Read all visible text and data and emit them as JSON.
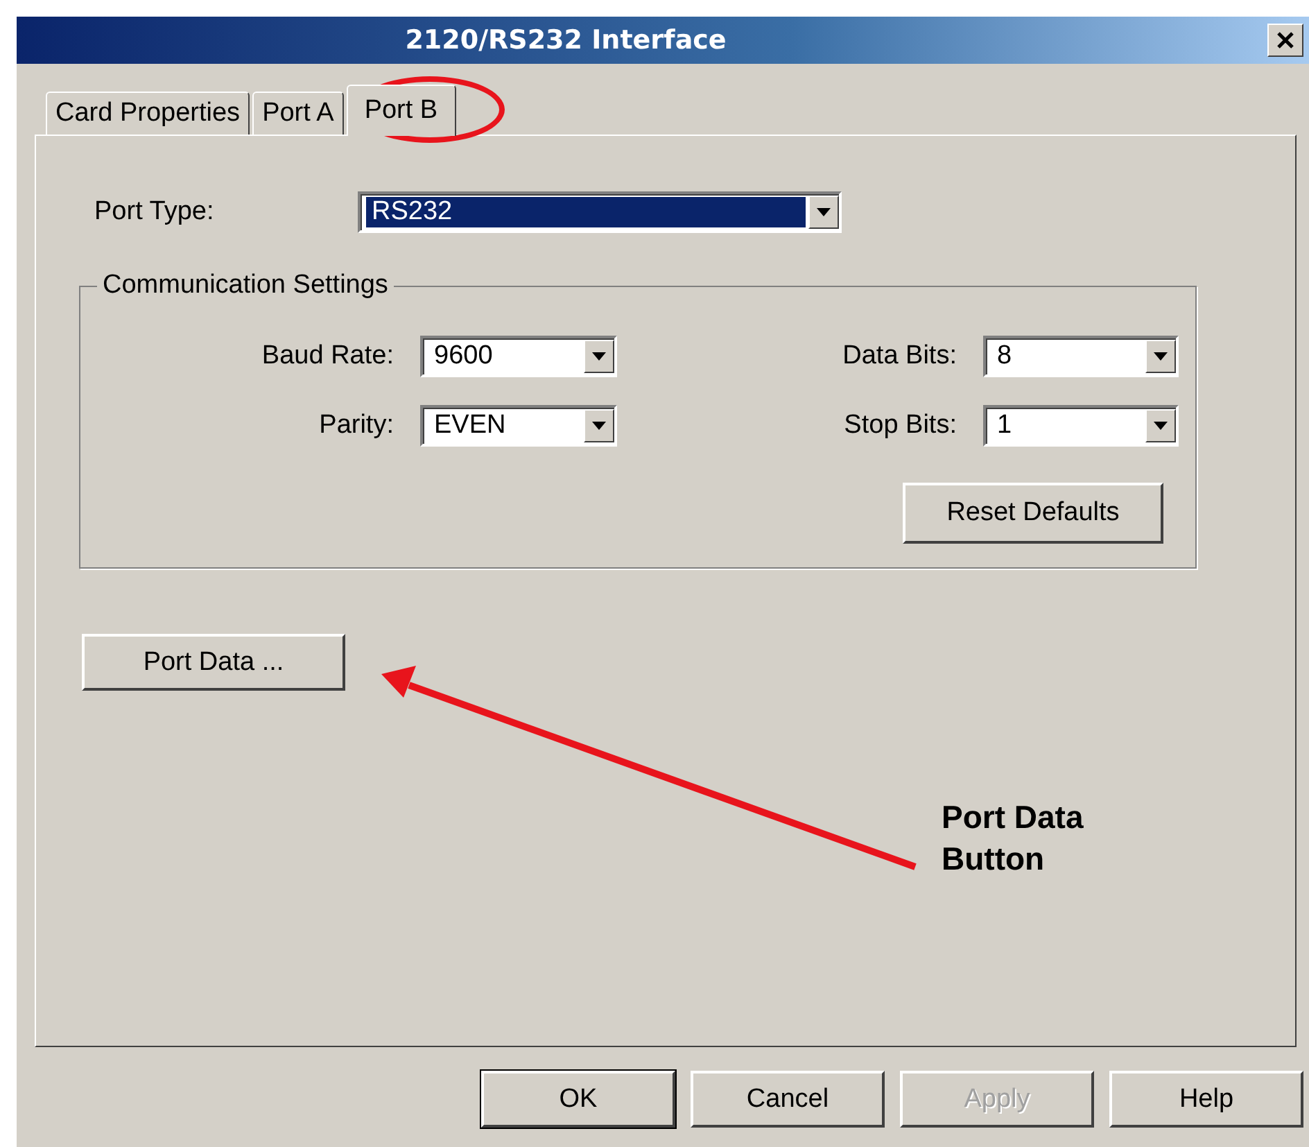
{
  "window": {
    "title": "2120/RS232 Interface"
  },
  "tabs": [
    {
      "label": "Card Properties",
      "selected": false
    },
    {
      "label": "Port A",
      "selected": false
    },
    {
      "label": "Port B",
      "selected": true
    }
  ],
  "port_type": {
    "label": "Port Type:",
    "value": "RS232",
    "focused": true
  },
  "communication_settings": {
    "title": "Communication Settings",
    "fields": [
      {
        "label": "Baud Rate:",
        "value": "9600"
      },
      {
        "label": "Data Bits:",
        "value": "8"
      },
      {
        "label": "Parity:",
        "value": "EVEN"
      },
      {
        "label": "Stop Bits:",
        "value": "1"
      }
    ],
    "reset_button": "Reset Defaults"
  },
  "port_data_button": "Port Data ...",
  "annotation": {
    "text": "Port Data Button"
  },
  "buttons": [
    {
      "label": "OK",
      "default": true,
      "disabled": false
    },
    {
      "label": "Cancel",
      "default": false,
      "disabled": false
    },
    {
      "label": "Apply",
      "default": false,
      "disabled": true
    },
    {
      "label": "Help",
      "default": false,
      "disabled": false
    }
  ]
}
